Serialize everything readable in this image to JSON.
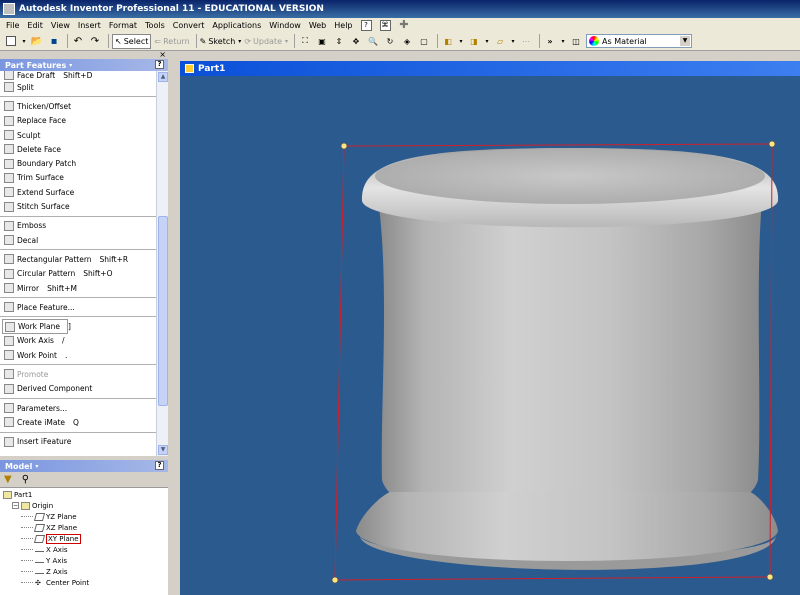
{
  "app": {
    "title": "Autodesk Inventor Professional 11 - EDUCATIONAL VERSION"
  },
  "menu": [
    "File",
    "Edit",
    "View",
    "Insert",
    "Format",
    "Tools",
    "Convert",
    "Applications",
    "Window",
    "Web",
    "Help"
  ],
  "toolbar": {
    "select_label": "Select",
    "return_label": "Return",
    "sketch_label": "Sketch",
    "update_label": "Update",
    "material_value": "As Material"
  },
  "panel": {
    "title": "Part Features",
    "items": [
      {
        "label": "Face Draft",
        "shortcut": "Shift+D",
        "icon": "face-draft-icon",
        "dim": false
      },
      {
        "label": "Split",
        "shortcut": "",
        "icon": "split-icon",
        "dim": false
      },
      {
        "label": "Thicken/Offset",
        "shortcut": "",
        "icon": "thicken-icon",
        "dim": false
      },
      {
        "label": "Replace Face",
        "shortcut": "",
        "icon": "replace-face-icon",
        "dim": false
      },
      {
        "label": "Sculpt",
        "shortcut": "",
        "icon": "sculpt-icon",
        "dim": false
      },
      {
        "label": "Delete Face",
        "shortcut": "",
        "icon": "delete-face-icon",
        "dim": false
      },
      {
        "label": "Boundary Patch",
        "shortcut": "",
        "icon": "boundary-patch-icon",
        "dim": false
      },
      {
        "label": "Trim Surface",
        "shortcut": "",
        "icon": "trim-surface-icon",
        "dim": false
      },
      {
        "label": "Extend Surface",
        "shortcut": "",
        "icon": "extend-surface-icon",
        "dim": false
      },
      {
        "label": "Stitch Surface",
        "shortcut": "",
        "icon": "stitch-surface-icon",
        "dim": false
      },
      {
        "label": "Emboss",
        "shortcut": "",
        "icon": "emboss-icon",
        "dim": false
      },
      {
        "label": "Decal",
        "shortcut": "",
        "icon": "decal-icon",
        "dim": false
      },
      {
        "label": "Rectangular Pattern",
        "shortcut": "Shift+R",
        "icon": "rectangular-pattern-icon",
        "dim": false
      },
      {
        "label": "Circular Pattern",
        "shortcut": "Shift+O",
        "icon": "circular-pattern-icon",
        "dim": false
      },
      {
        "label": "Mirror",
        "shortcut": "Shift+M",
        "icon": "mirror-icon",
        "dim": false
      },
      {
        "label": "Place Feature...",
        "shortcut": "",
        "icon": "place-feature-icon",
        "dim": false
      },
      {
        "label": "Work Plane",
        "shortcut": "]",
        "icon": "work-plane-icon",
        "dim": false
      },
      {
        "label": "Work Axis",
        "shortcut": "/",
        "icon": "work-axis-icon",
        "dim": false
      },
      {
        "label": "Work Point",
        "shortcut": ".",
        "icon": "work-point-icon",
        "dim": false
      },
      {
        "label": "Promote",
        "shortcut": "",
        "icon": "promote-icon",
        "dim": true
      },
      {
        "label": "Derived Component",
        "shortcut": "",
        "icon": "derived-component-icon",
        "dim": false
      },
      {
        "label": "Parameters...",
        "shortcut": "",
        "icon": "parameters-icon",
        "dim": false
      },
      {
        "label": "Create iMate",
        "shortcut": "Q",
        "icon": "create-imate-icon",
        "dim": false
      },
      {
        "label": "Insert iFeature",
        "shortcut": "",
        "icon": "insert-ifeature-icon",
        "dim": false
      }
    ]
  },
  "browser": {
    "title": "Model",
    "tree": [
      {
        "label": "Part1",
        "level": 0,
        "kind": "part"
      },
      {
        "label": "Origin",
        "level": 1,
        "kind": "folder"
      },
      {
        "label": "YZ Plane",
        "level": 2,
        "kind": "plane"
      },
      {
        "label": "XZ Plane",
        "level": 2,
        "kind": "plane"
      },
      {
        "label": "XY Plane",
        "level": 2,
        "kind": "plane-selected"
      },
      {
        "label": "X Axis",
        "level": 2,
        "kind": "axis"
      },
      {
        "label": "Y Axis",
        "level": 2,
        "kind": "axis"
      },
      {
        "label": "Z Axis",
        "level": 2,
        "kind": "axis"
      },
      {
        "label": "Center Point",
        "level": 2,
        "kind": "point"
      }
    ]
  },
  "document": {
    "title": "Part1"
  },
  "colors": {
    "viewport_bg": "#2b5a8e",
    "title_blue": "#0a246a",
    "selection_red": "#d0202a"
  }
}
